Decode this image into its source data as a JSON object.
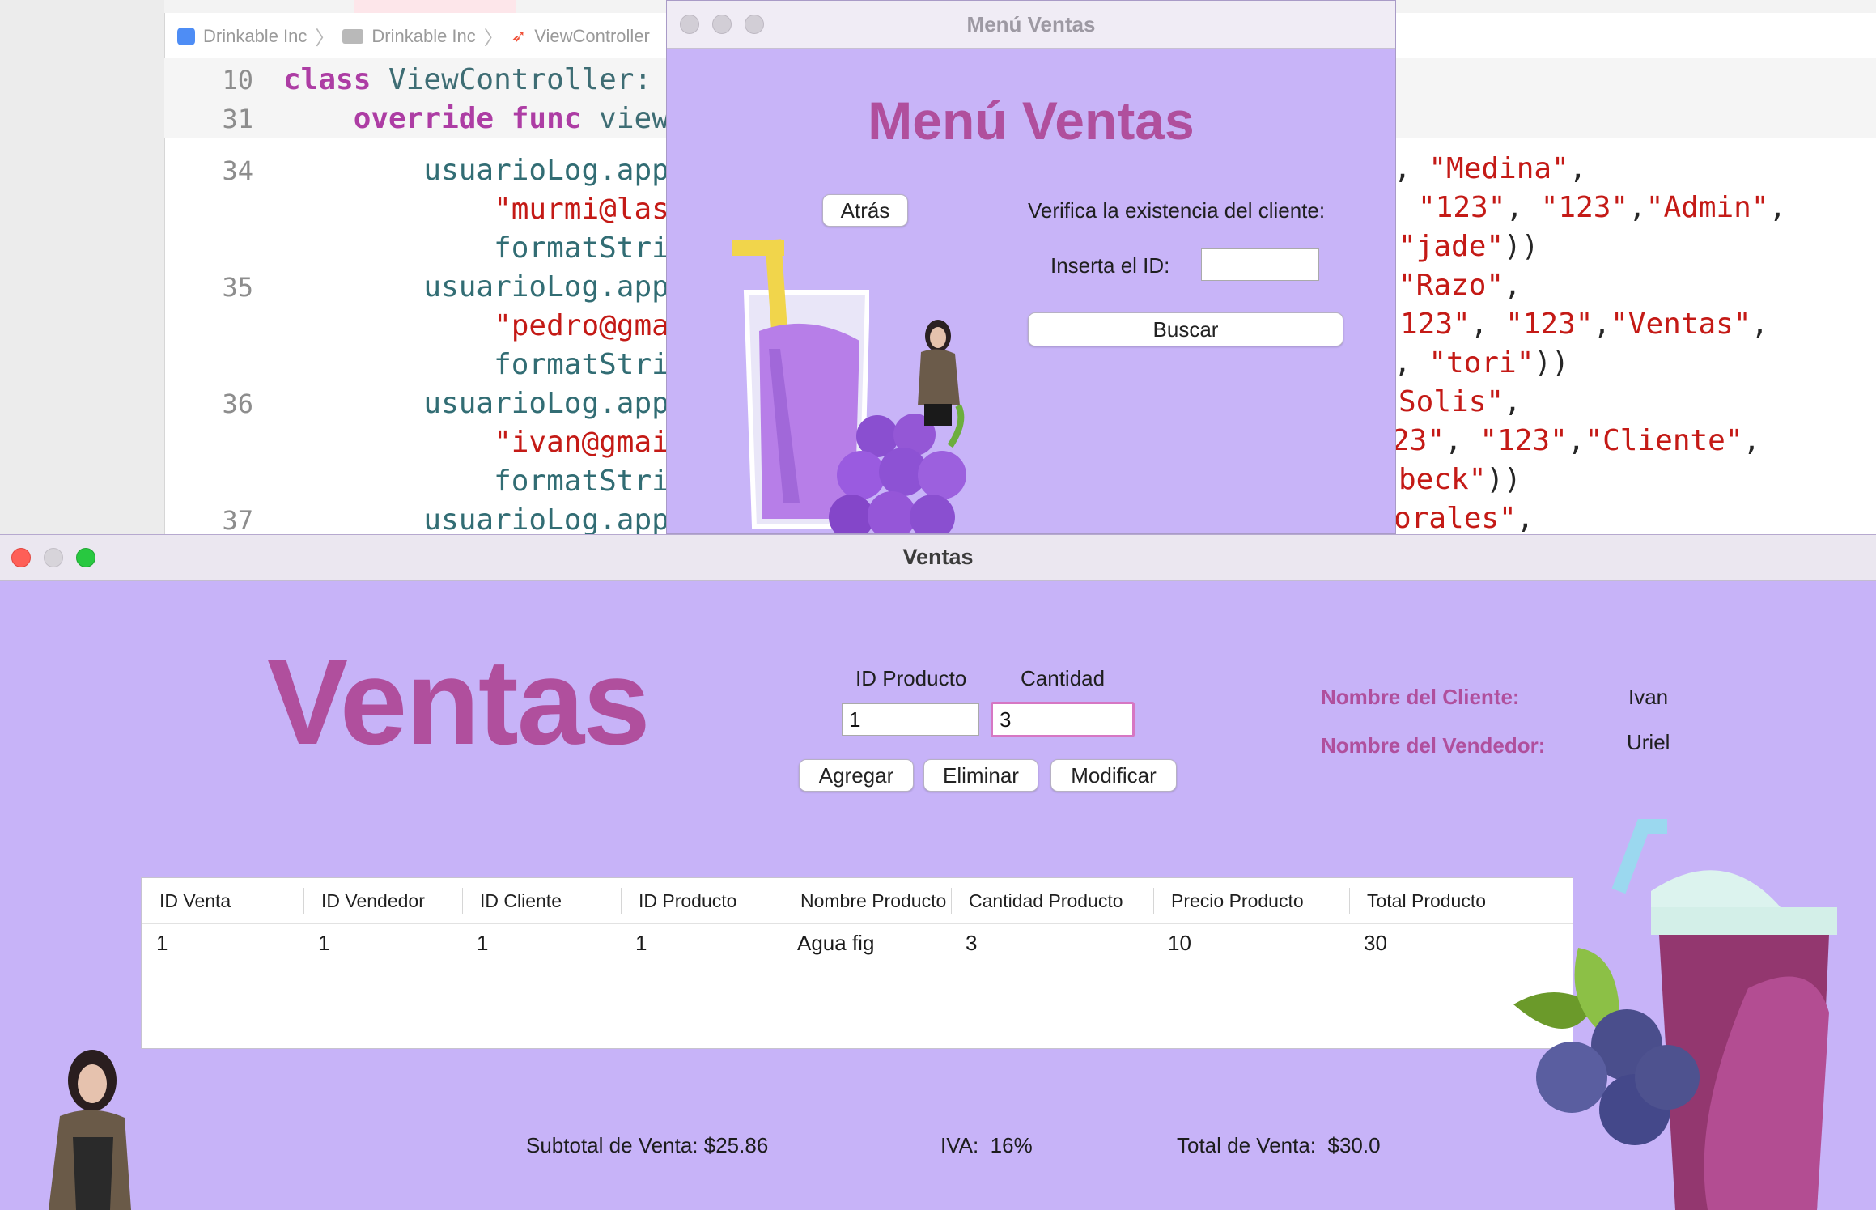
{
  "xcode": {
    "breadcrumb": [
      "Drinkable Inc",
      "Drinkable Inc",
      "ViewController"
    ],
    "lines": [
      {
        "num": "10",
        "tokens": [
          {
            "t": "class ",
            "c": "kw"
          },
          {
            "t": "ViewController:",
            "c": "ty"
          }
        ]
      },
      {
        "num": "31",
        "tokens": [
          {
            "t": "    override func ",
            "c": "kw"
          },
          {
            "t": "view",
            "c": "fn"
          }
        ]
      },
      {
        "num": "34",
        "tokens": [
          {
            "t": "        usuarioLog.app",
            "c": "idf"
          }
        ]
      },
      {
        "num": "",
        "tokens": [
          {
            "t": "            \"murmi@las",
            "c": "str"
          }
        ]
      },
      {
        "num": "",
        "tokens": [
          {
            "t": "            formatStri",
            "c": "idf"
          }
        ]
      },
      {
        "num": "35",
        "tokens": [
          {
            "t": "        usuarioLog.app",
            "c": "idf"
          }
        ]
      },
      {
        "num": "",
        "tokens": [
          {
            "t": "            \"pedro@gma",
            "c": "str"
          }
        ]
      },
      {
        "num": "",
        "tokens": [
          {
            "t": "            formatStri",
            "c": "idf"
          }
        ]
      },
      {
        "num": "36",
        "tokens": [
          {
            "t": "        usuarioLog.app",
            "c": "idf"
          }
        ]
      },
      {
        "num": "",
        "tokens": [
          {
            "t": "            \"ivan@gmai",
            "c": "str"
          }
        ]
      },
      {
        "num": "",
        "tokens": [
          {
            "t": "            formatStri",
            "c": "idf"
          }
        ]
      },
      {
        "num": "37",
        "tokens": [
          {
            "t": "        usuarioLog.app",
            "c": "idf"
          }
        ]
      }
    ],
    "right_lines": [
      {
        "tokens": [
          {
            "t": ", ",
            "c": ""
          },
          {
            "t": "\"Medina\"",
            "c": "str"
          },
          {
            "t": ",",
            "c": ""
          }
        ]
      },
      {
        "tokens": [
          {
            "t": "\"123\"",
            "c": "str"
          },
          {
            "t": ", ",
            "c": ""
          },
          {
            "t": "\"123\"",
            "c": "str"
          },
          {
            "t": ",",
            "c": ""
          },
          {
            "t": "\"Admin\"",
            "c": "str"
          },
          {
            "t": ",",
            "c": ""
          }
        ]
      },
      {
        "tokens": [
          {
            "t": "\"jade\"",
            "c": "str"
          },
          {
            "t": "))",
            "c": ""
          }
        ]
      },
      {
        "tokens": [
          {
            "t": "\"Razo\"",
            "c": "str"
          },
          {
            "t": ",",
            "c": ""
          }
        ]
      },
      {
        "tokens": [
          {
            "t": "123\"",
            "c": "str"
          },
          {
            "t": ", ",
            "c": ""
          },
          {
            "t": "\"123\"",
            "c": "str"
          },
          {
            "t": ",",
            "c": ""
          },
          {
            "t": "\"Ventas\"",
            "c": "str"
          },
          {
            "t": ",",
            "c": ""
          }
        ]
      },
      {
        "tokens": [
          {
            "t": ", ",
            "c": ""
          },
          {
            "t": "\"tori\"",
            "c": "str"
          },
          {
            "t": "))",
            "c": ""
          }
        ]
      },
      {
        "tokens": [
          {
            "t": "Solis\"",
            "c": "str"
          },
          {
            "t": ",",
            "c": ""
          }
        ]
      },
      {
        "tokens": [
          {
            "t": "23\"",
            "c": "str"
          },
          {
            "t": ", ",
            "c": ""
          },
          {
            "t": "\"123\"",
            "c": "str"
          },
          {
            "t": ",",
            "c": ""
          },
          {
            "t": "\"Cliente\"",
            "c": "str"
          },
          {
            "t": ",",
            "c": ""
          }
        ]
      },
      {
        "tokens": [
          {
            "t": "beck\"",
            "c": "str"
          },
          {
            "t": "))",
            "c": ""
          }
        ]
      },
      {
        "tokens": [
          {
            "t": "orales\"",
            "c": "str"
          },
          {
            "t": ",",
            "c": ""
          }
        ]
      }
    ]
  },
  "menu_window": {
    "title": "Menú Ventas",
    "heading": "Menú Ventas",
    "back_label": "Atrás",
    "verify_label": "Verifica la existencia del cliente:",
    "id_label": "Inserta el ID:",
    "id_value": "",
    "search_label": "Buscar"
  },
  "ventas_window": {
    "title": "Ventas",
    "heading": "Ventas",
    "product_id_label": "ID Producto",
    "quantity_label": "Cantidad",
    "product_id_value": "1",
    "quantity_value": "3",
    "add_label": "Agregar",
    "delete_label": "Eliminar",
    "modify_label": "Modificar",
    "client_name_label": "Nombre del Cliente:",
    "client_name_value": "Ivan",
    "seller_name_label": "Nombre del Vendedor:",
    "seller_name_value": "Uriel",
    "table": {
      "columns": [
        "ID Venta",
        "ID Vendedor",
        "ID Cliente",
        "ID Producto",
        "Nombre Producto",
        "Cantidad Producto",
        "Precio Producto",
        "Total Producto"
      ],
      "rows": [
        [
          "1",
          "1",
          "1",
          "1",
          "Agua fig",
          "3",
          "10",
          "30"
        ]
      ]
    },
    "subtotal_label": "Subtotal de Venta:",
    "subtotal_value": "$25.86",
    "iva_label": "IVA:",
    "iva_value": "16%",
    "total_label": "Total de Venta:",
    "total_value": "$30.0"
  },
  "colors": {
    "window_bg": "#c7b3f8",
    "heading_pink": "#b04f9d",
    "traffic_red": "#fe5f57",
    "traffic_yellow": "#d7d4da",
    "traffic_green": "#28c840"
  },
  "icons": [
    "app-icon",
    "folder-icon",
    "swift-file-icon",
    "juice-glass-illustration",
    "grapes-illustration",
    "smoothie-cup-illustration",
    "person-photo"
  ]
}
